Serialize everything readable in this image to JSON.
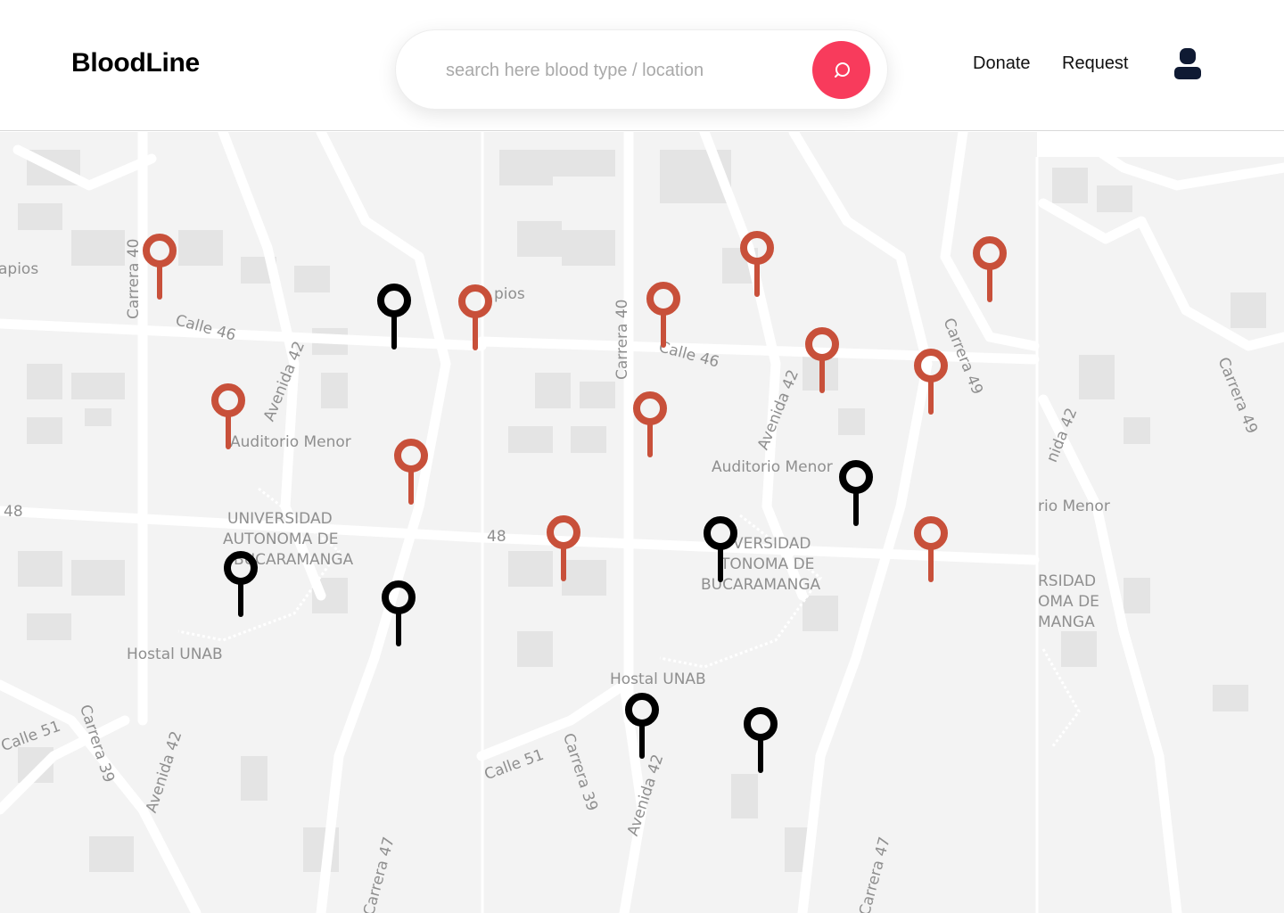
{
  "app": {
    "logo": "BloodLine"
  },
  "search": {
    "placeholder": "search here blood type / location"
  },
  "nav": {
    "donate_label": "Donate",
    "request_label": "Request"
  },
  "icons": {
    "search": "search-icon",
    "profile": "user-icon",
    "pin": "map-pin-icon"
  },
  "colors": {
    "accent": "#f83b5c",
    "pin_red": "#c8503a",
    "pin_black": "#000000"
  },
  "map": {
    "labels": [
      "apios",
      "Carrera 40",
      "Calle 46",
      "Avenida 42",
      "Auditorio Menor",
      "48",
      "UNIVERSIDAD",
      "AUTONOMA DE",
      "BUCARAMANGA",
      "Hostal UNAB",
      "Calle 51",
      "Carrera 39",
      "Avenida 42",
      "Carrera 47",
      "pios",
      "Carrera 40",
      "Calle 46",
      "Avenida 42",
      "Carrera 49",
      "Auditorio Menor",
      "48",
      "VERSIDAD",
      "TONOMA DE",
      "BUCARAMANGA",
      "Hostal UNAB",
      "Calle 51",
      "Carrera 39",
      "Avenida 42",
      "Carrera 47",
      "nida 42",
      "rio Menor",
      "RSIDAD",
      "OMA DE",
      "MANGA",
      "Carrera 49"
    ]
  }
}
